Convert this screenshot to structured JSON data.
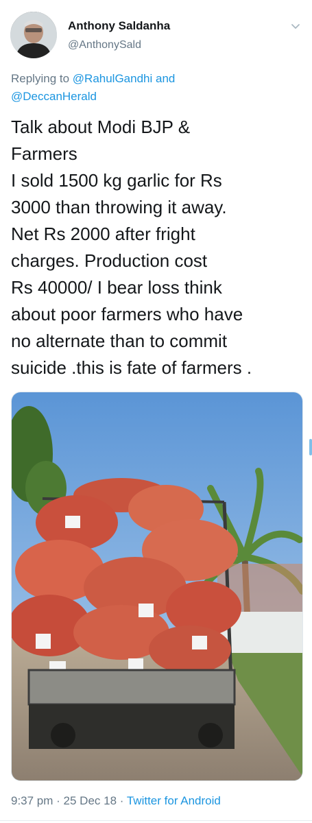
{
  "author": {
    "name": "Anthony Saldanha",
    "handle": "@AnthonySald"
  },
  "reply": {
    "prefix": "Replying to ",
    "mention1": "@RahulGandhi",
    "joiner": " and",
    "mention2": "@DeccanHerald"
  },
  "tweet": {
    "text": "Talk about Modi BJP &\nFarmers\nI sold 1500 kg garlic for Rs\n3000 than throwing it away.\nNet Rs 2000 after fright\ncharges. Production cost\nRs 40000/ I bear loss think\nabout poor farmers who have\nno alternate than to commit\nsuicide .this is fate of farmers ."
  },
  "meta": {
    "time": "9:37 pm",
    "sep1": " · ",
    "date": "25 Dec 18",
    "sep2": " · ",
    "source": "Twitter for Android"
  },
  "icons": {
    "menu": "chevron-down-icon"
  },
  "colors": {
    "link": "#1b95e0",
    "secondary_text": "#657786",
    "primary_text": "#14171a"
  }
}
